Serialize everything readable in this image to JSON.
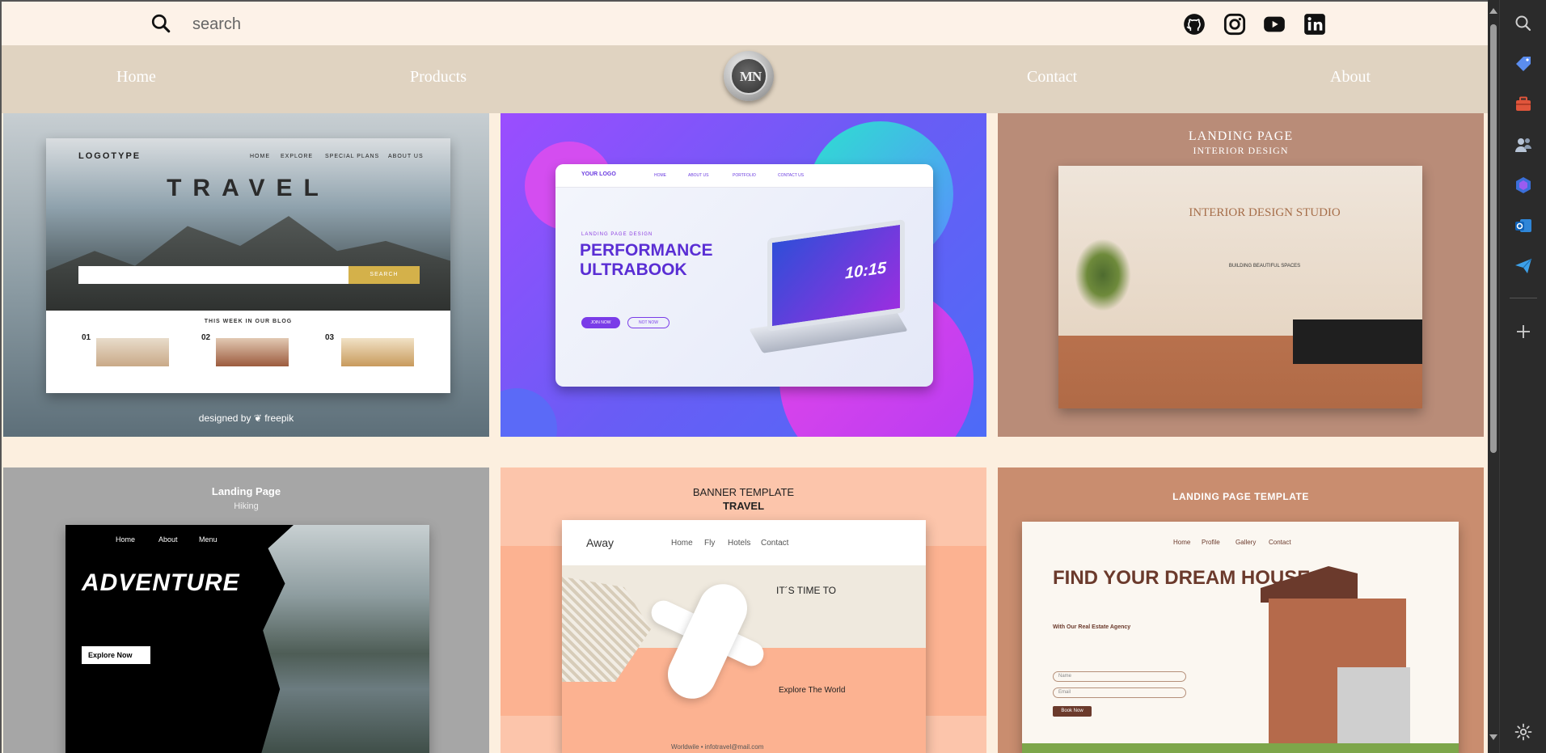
{
  "search": {
    "placeholder": "search"
  },
  "social": [
    "github-icon",
    "instagram-icon",
    "youtube-icon",
    "linkedin-icon"
  ],
  "nav": {
    "home": "Home",
    "products": "Products",
    "logo_text": "MN",
    "contact": "Contact",
    "about": "About"
  },
  "cards": {
    "travel": {
      "logo": "LOGOTYPE",
      "menu": [
        "HOME",
        "EXPLORE",
        "SPECIAL PLANS",
        "ABOUT US"
      ],
      "title": "TRAVEL",
      "search_btn": "SEARCH",
      "blog_heading": "THIS WEEK IN OUR BLOG",
      "blog_nums": [
        "01",
        "02",
        "03"
      ],
      "credit": "designed by ❦ freepik"
    },
    "ultrabook": {
      "logo": "YOUR LOGO",
      "menu": [
        "HOME",
        "ABOUT US",
        "PORTFOLIO",
        "CONTACT US"
      ],
      "eyebrow": "LANDING PAGE DESIGN",
      "title": "PERFORMANCE ULTRABOOK",
      "btn1": "JOIN NOW",
      "btn2": "NOT NOW",
      "time": "10:15"
    },
    "interior": {
      "heading1": "LANDING PAGE",
      "heading2": "INTERIOR DESIGN",
      "title": "INTERIOR DESIGN STUDIO",
      "subtitle": "BUILDING BEAUTIFUL SPACES"
    },
    "adventure": {
      "heading1": "Landing Page",
      "heading2": "Hiking",
      "menu": [
        "Home",
        "About",
        "Menu"
      ],
      "title": "ADVENTURE",
      "btn": "Explore Now"
    },
    "away": {
      "heading1": "BANNER TEMPLATE",
      "heading2": "TRAVEL",
      "logo": "Away",
      "menu": [
        "Home",
        "Fly",
        "Hotels",
        "Contact"
      ],
      "tagline": "IT´S TIME TO",
      "section": "Explore The World",
      "footer": "Worldwile   •   infotravel@mail.com"
    },
    "house": {
      "heading": "LANDING PAGE TEMPLATE",
      "menu": [
        "Home",
        "Profile",
        "Gallery",
        "Contact"
      ],
      "title": "FIND YOUR DREAM HOUSE",
      "subtitle": "With Our Real Estate Agency",
      "field1": "Name",
      "field2": "Email",
      "btn": "Book Now"
    }
  },
  "sidebar": [
    "search-icon",
    "tag-icon",
    "briefcase-icon",
    "people-icon",
    "copilot-icon",
    "outlook-icon",
    "send-icon",
    "add-icon",
    "settings-icon"
  ],
  "colors": {
    "page_bg": "#fcefdf",
    "topbar_bg": "#fdf2e8",
    "navbar_bg": "#e0d3c1",
    "chrome_bg": "#2b2b2b"
  }
}
